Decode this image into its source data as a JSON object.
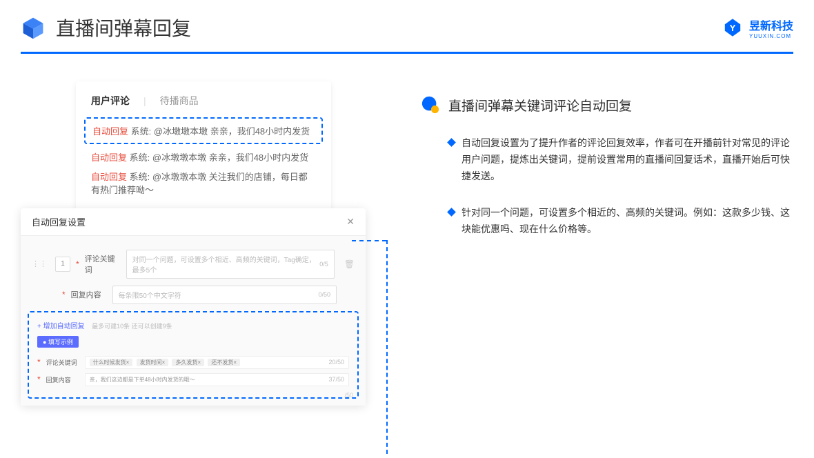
{
  "header": {
    "title": "直播间弹幕回复",
    "brand_name": "昱新科技",
    "brand_url": "YUUXIN.COM"
  },
  "comments_card": {
    "tab_active": "用户评论",
    "tab_inactive": "待播商品",
    "badge": "自动回复",
    "system_label": "系统:",
    "highlighted": "@冰墩墩本墩 亲亲，我们48小时内发货",
    "line2": "@冰墩墩本墩 亲亲，我们48小时内发货",
    "line3": "@冰墩墩本墩 关注我们的店铺，每日都有热门推荐呦～"
  },
  "dialog": {
    "title": "自动回复设置",
    "row_num": "1",
    "label_keyword": "评论关键词",
    "placeholder_keyword": "对同一个问题，可设置多个相近、高频的关键词，Tag确定，最多5个",
    "count_keyword": "0/5",
    "label_content": "回复内容",
    "placeholder_content": "每条限50个中文字符",
    "count_content": "0/50",
    "add_link": "+ 增加自动回复",
    "add_hint": "最多可建10条 还可以创建9条",
    "example_badge": "● 填写示例",
    "ex_label_kw": "评论关键词",
    "ex_tags": [
      "什么时候发货×",
      "发货时间×",
      "多久发货×",
      "还不发货×"
    ],
    "ex_kw_count": "20/50",
    "ex_label_content": "回复内容",
    "ex_content_text": "亲，我们这边都是下单48小时内发货的哦～",
    "ex_content_count": "37/50",
    "bottom_count": "/50"
  },
  "right": {
    "section_title": "直播间弹幕关键词评论自动回复",
    "bullet1": "自动回复设置为了提升作者的评论回复效率，作者可在开播前针对常见的评论用户问题，提炼出关键词，提前设置常用的直播间回复话术，直播开始后可快捷发送。",
    "bullet2": "针对同一个问题，可设置多个相近的、高频的关键词。例如：这款多少钱、这块能优惠吗、现在什么价格等。"
  }
}
